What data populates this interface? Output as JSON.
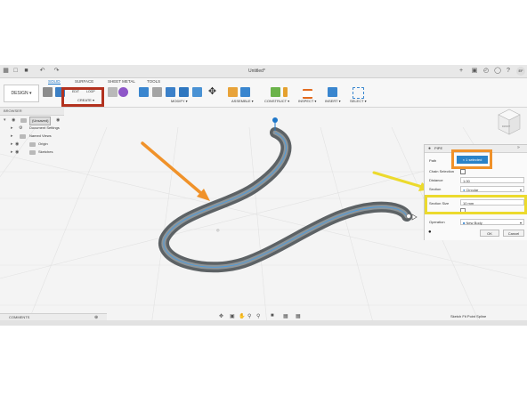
{
  "app": {
    "document_title": "Untitled*",
    "user_initials": "EF"
  },
  "ribbon": {
    "workspace": "DESIGN ▾",
    "tabs": [
      "SOLID",
      "SURFACE",
      "SHEET METAL",
      "TOOLS"
    ],
    "active_tab": "SOLID",
    "create_sub": [
      "EDIT",
      "LOOP"
    ],
    "groups": [
      "CREATE ▾",
      "MODIFY ▾",
      "ASSEMBLE ▾",
      "CONSTRUCT ▾",
      "INSPECT ▾",
      "INSERT ▾",
      "SELECT ▾"
    ]
  },
  "browser": {
    "title": "BROWSER",
    "items": [
      {
        "label": "(Unsaved)"
      },
      {
        "label": "Document Settings"
      },
      {
        "label": "Named Views"
      },
      {
        "label": "Origin"
      },
      {
        "label": "Sketches"
      }
    ]
  },
  "pipe_panel": {
    "title": "PIPE",
    "path_label": "Path",
    "path_value": "1 selected",
    "chain_label": "Chain Selection",
    "distance_label": "Distance",
    "distance_value": "1.00",
    "section_label": "Section",
    "section_value": "Circular",
    "section_size_label": "Section Size",
    "section_size_value": "10 mm",
    "operation_label": "Operation",
    "operation_value": "New Body",
    "ok_label": "OK",
    "cancel_label": "Cancel"
  },
  "viewcube": {
    "label": "FRONT"
  },
  "status": {
    "comments_label": "COMMENTS",
    "right_text": "Sketch Fit Point Spline"
  },
  "colors": {
    "annotation_red": "#b3321f",
    "annotation_orange": "#f0922a",
    "annotation_yellow": "#ecda2d",
    "accent_blue": "#2a83c9",
    "pipe_body": "#6b7073"
  }
}
